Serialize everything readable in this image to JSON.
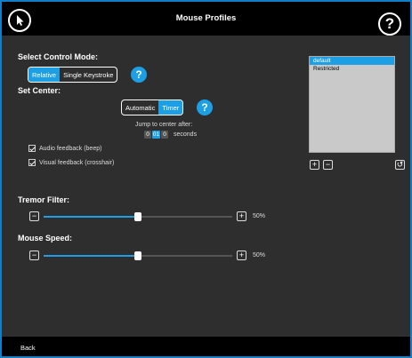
{
  "header": {
    "title": "Mouse Profiles",
    "help_glyph": "?"
  },
  "control_mode": {
    "heading": "Select Control Mode:",
    "options": [
      "Relative",
      "Single Keystroke"
    ],
    "selected": "Relative",
    "help_glyph": "?"
  },
  "center": {
    "heading": "Set Center:",
    "options": [
      "Automatic",
      "Timer"
    ],
    "selected": "Timer",
    "help_glyph": "?",
    "jump_label": "Jump to center after:",
    "digits": [
      "0",
      "01",
      "0"
    ],
    "seconds_label": "seconds"
  },
  "feedback": {
    "audio": {
      "label": "Audio feedback (beep)",
      "checked": true
    },
    "visual": {
      "label": "Visual feedback (crosshair)",
      "checked": true
    }
  },
  "profiles": {
    "items": [
      "default",
      "Restricted"
    ],
    "selected": "default",
    "add_glyph": "+",
    "remove_glyph": "−",
    "refresh_glyph": "↺"
  },
  "tremor": {
    "heading": "Tremor Filter:",
    "value_pct": 50,
    "value_label": "50%",
    "minus": "−",
    "plus": "+"
  },
  "speed": {
    "heading": "Mouse Speed:",
    "value_pct": 50,
    "value_label": "50%",
    "minus": "−",
    "plus": "+"
  },
  "footer": {
    "back_label": "Back"
  },
  "colors": {
    "accent": "#1d9fe6",
    "frame": "#0f80c8",
    "background": "#2e2e2e",
    "bar": "#000000"
  }
}
